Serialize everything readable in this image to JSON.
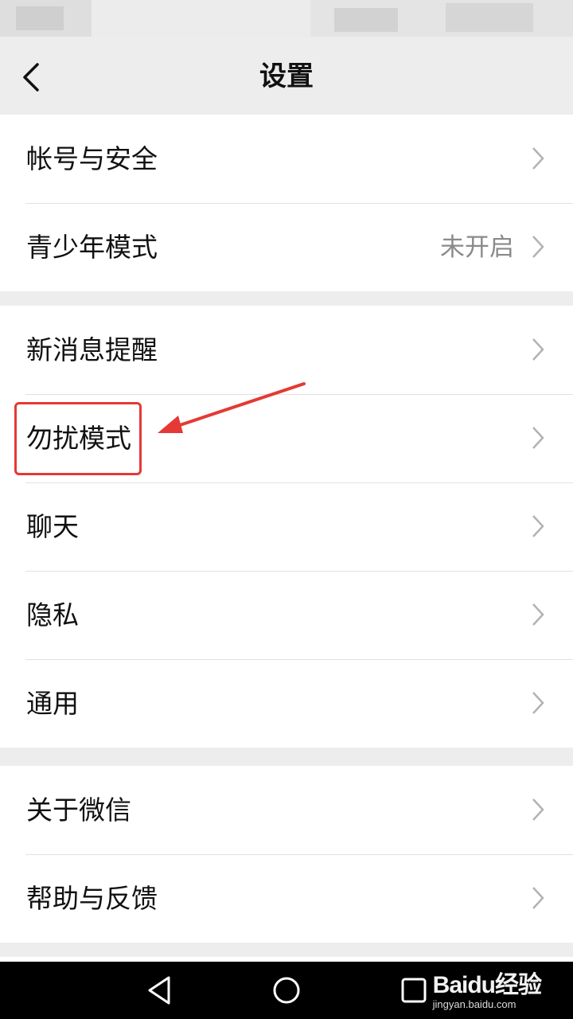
{
  "header": {
    "title": "设置",
    "back_icon": "chevron-left-icon"
  },
  "groups": [
    {
      "items": [
        {
          "label": "帐号与安全",
          "value": ""
        },
        {
          "label": "青少年模式",
          "value": "未开启"
        }
      ]
    },
    {
      "items": [
        {
          "label": "新消息提醒",
          "value": ""
        },
        {
          "label": "勿扰模式",
          "value": "",
          "highlighted": true
        },
        {
          "label": "聊天",
          "value": ""
        },
        {
          "label": "隐私",
          "value": ""
        },
        {
          "label": "通用",
          "value": ""
        }
      ]
    },
    {
      "items": [
        {
          "label": "关于微信",
          "value": ""
        },
        {
          "label": "帮助与反馈",
          "value": ""
        }
      ]
    }
  ],
  "annotation": {
    "color": "#e53935"
  },
  "system_nav": {
    "buttons": [
      "back-triangle-icon",
      "home-circle-icon",
      "recents-square-icon"
    ]
  },
  "watermark": {
    "logo": "Baidu经验",
    "url": "jingyan.baidu.com"
  }
}
